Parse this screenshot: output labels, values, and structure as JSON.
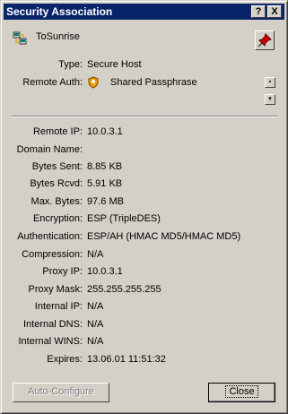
{
  "window": {
    "title": "Security Association"
  },
  "titlebar": {
    "help_glyph": "?",
    "close_glyph": "X"
  },
  "connection": {
    "name": "ToSunrise",
    "icon": "network-connection-icon"
  },
  "pin": {
    "icon": "pushpin-icon",
    "color": "#cc0000"
  },
  "top_fields": [
    {
      "label": "Type:",
      "value": "Secure Host"
    },
    {
      "label": "Remote Auth:",
      "value": "Shared Passphrase",
      "icon": "key-shield-icon"
    }
  ],
  "details": [
    {
      "label": "Remote IP:",
      "value": "10.0.3.1"
    },
    {
      "label": "Domain Name:",
      "value": ""
    },
    {
      "label": "Bytes Sent:",
      "value": "8.85 KB"
    },
    {
      "label": "Bytes Rcvd:",
      "value": "5.91 KB"
    },
    {
      "label": "Max. Bytes:",
      "value": "97.6 MB"
    },
    {
      "label": "Encryption:",
      "value": "ESP (TripleDES)"
    },
    {
      "label": "Authentication:",
      "value": "ESP/AH (HMAC MD5/HMAC MD5)"
    },
    {
      "label": "Compression:",
      "value": "N/A"
    },
    {
      "label": "Proxy IP:",
      "value": "10.0.3.1"
    },
    {
      "label": "Proxy Mask:",
      "value": "255.255.255.255"
    },
    {
      "label": "Internal IP:",
      "value": "N/A"
    },
    {
      "label": "Internal DNS:",
      "value": "N/A"
    },
    {
      "label": "Internal WINS:",
      "value": "N/A"
    },
    {
      "label": "Expires:",
      "value": "13.06.01 11:51:32"
    }
  ],
  "buttons": {
    "auto_configure": "Auto-Configure",
    "close": "Close"
  },
  "colors": {
    "titlebar": "#0a246a",
    "face": "#d4d0c8",
    "disabled_text": "#808080"
  }
}
